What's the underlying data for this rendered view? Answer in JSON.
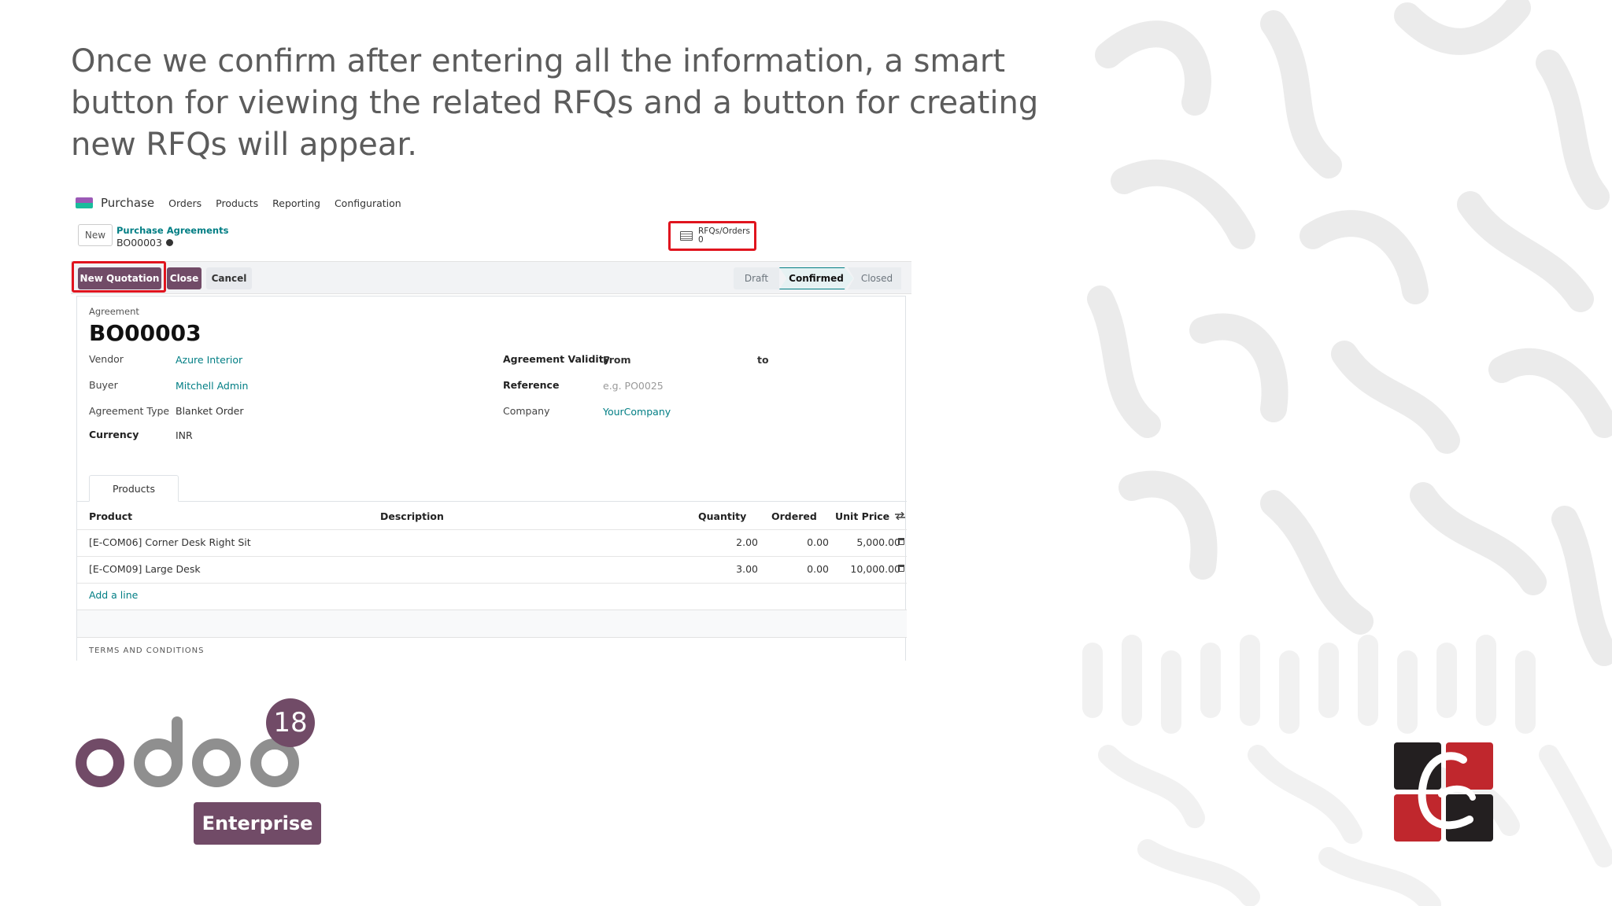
{
  "caption": "Once we confirm after entering all the information, a smart button for viewing the related RFQs and a button for creating new RFQs will appear.",
  "navbar": {
    "app_name": "Purchase",
    "menu": [
      "Orders",
      "Products",
      "Reporting",
      "Configuration"
    ]
  },
  "breadcrumb": {
    "new_label": "New",
    "parent": "Purchase Agreements",
    "current": "BO00003"
  },
  "smart_button": {
    "label": "RFQs/Orders",
    "count": "0",
    "icon": "document-list-icon"
  },
  "actions": {
    "new_quotation": "New Quotation",
    "close": "Close",
    "cancel": "Cancel"
  },
  "statusbar": {
    "stages": [
      "Draft",
      "Confirmed",
      "Closed"
    ],
    "active": "Confirmed"
  },
  "form": {
    "agreement_label": "Agreement",
    "reference_number": "BO00003",
    "left_fields": [
      {
        "label": "Vendor",
        "value": "Azure Interior"
      },
      {
        "label": "Buyer",
        "value": "Mitchell Admin"
      },
      {
        "label": "Agreement Type",
        "value": "Blanket Order"
      },
      {
        "label": "Currency",
        "value": "INR"
      }
    ],
    "right_fields": {
      "validity_label": "Agreement Validity",
      "from_label": "From",
      "to_label": "to",
      "reference_label": "Reference",
      "reference_placeholder": "e.g. PO0025",
      "company_label": "Company",
      "company_value": "YourCompany"
    },
    "tab": "Products",
    "table": {
      "columns": [
        "Product",
        "Description",
        "Quantity",
        "Ordered",
        "Unit Price"
      ],
      "rows": [
        {
          "product": "[E-COM06] Corner Desk Right Sit",
          "description": "",
          "quantity": "2.00",
          "ordered": "0.00",
          "unit_price": "5,000.00"
        },
        {
          "product": "[E-COM09] Large Desk",
          "description": "",
          "quantity": "3.00",
          "ordered": "0.00",
          "unit_price": "10,000.00"
        }
      ],
      "add_line": "Add a line"
    },
    "terms_label": "TERMS AND CONDITIONS"
  },
  "branding": {
    "odoo_version": "18",
    "edition": "Enterprise",
    "accent_color": "#714b67",
    "link_color": "#017e84",
    "highlight_color": "#e0141e"
  }
}
